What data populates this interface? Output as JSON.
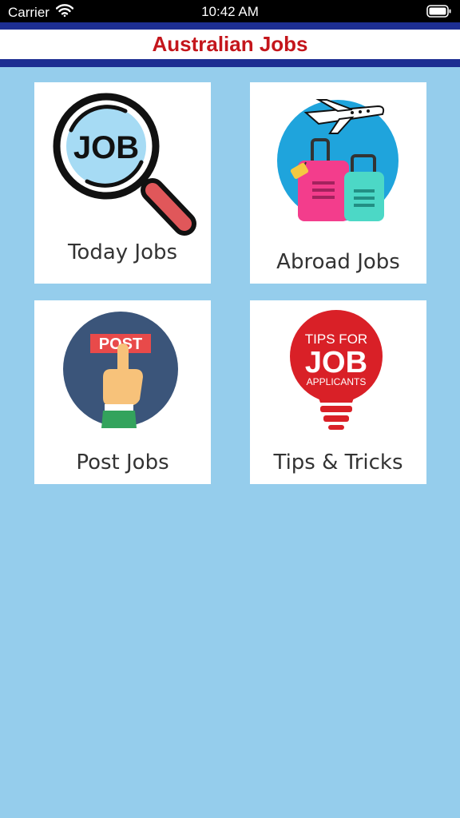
{
  "status_bar": {
    "carrier": "Carrier",
    "time": "10:42 AM",
    "wifi_icon": "wifi-icon",
    "battery_icon": "battery-icon"
  },
  "nav": {
    "title": "Australian Jobs",
    "title_color": "#c4161c",
    "stripe_color": "#1d2e92"
  },
  "background_color": "#95cdec",
  "menu": [
    {
      "label": "Today Jobs",
      "icon": "job-search-magnifier-icon"
    },
    {
      "label": "Abroad Jobs",
      "icon": "airplane-luggage-icon"
    },
    {
      "label": "Post Jobs",
      "icon": "post-hand-icon"
    },
    {
      "label": "Tips & Tricks",
      "icon": "tips-lightbulb-icon",
      "icon_text": [
        "TIPS FOR",
        "JOB",
        "APPLICANTS"
      ]
    }
  ]
}
